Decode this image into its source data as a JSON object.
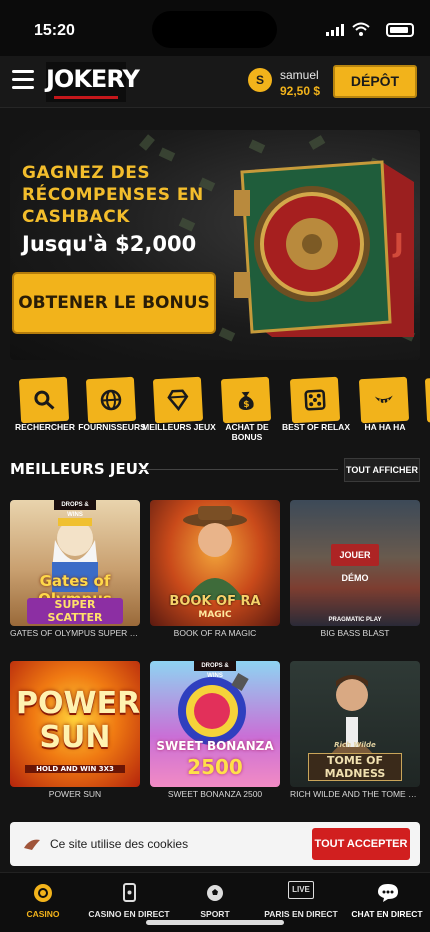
{
  "status_bar": {
    "time": "15:20"
  },
  "header": {
    "logo_text": "JOKERY",
    "username": "samuel",
    "balance": "92,50 $",
    "avatar_letter": "S",
    "deposit_label": "DÉPÔT"
  },
  "banner": {
    "headline": "GAGNEZ DES RÉCOMPENSES EN CASHBACK",
    "amount": "Jusqu'à $2,000",
    "cta_label": "OBTENER LE BONUS"
  },
  "categories": [
    {
      "label": "RECHERCHER",
      "icon": "search-icon"
    },
    {
      "label": "FOURNISSEURS",
      "icon": "globe-icon"
    },
    {
      "label": "MEILLEURS JEUX",
      "icon": "diamond-icon"
    },
    {
      "label": "ACHAT DE BONUS",
      "icon": "money-bag-icon"
    },
    {
      "label": "BEST OF RELAX",
      "icon": "dice-icon"
    },
    {
      "label": "HA HA HA",
      "icon": "joker-smile-icon"
    }
  ],
  "section": {
    "title": "MEILLEURS JEUX",
    "show_all_label": "TOUT AFFICHER"
  },
  "games": [
    {
      "name": "GATES OF OLYMPUS SUPER SCATTER",
      "thumb_title": "Gates of Olympus",
      "thumb_sub": "SUPER SCATTER",
      "tag": "DROPS & WINS"
    },
    {
      "name": "BOOK OF RA MAGIC",
      "thumb_title": "BOOK OF RA",
      "thumb_sub": "MAGIC"
    },
    {
      "name": "BIG BASS BLAST",
      "play_label": "JOUER",
      "demo_label": "DÉMO",
      "provider": "PRAGMATIC PLAY"
    },
    {
      "name": "POWER SUN",
      "thumb_title": "POWER SUN",
      "thumb_sub": "HOLD AND WIN 3X3"
    },
    {
      "name": "SWEET BONANZA 2500",
      "thumb_title": "SWEET BONANZA",
      "thumb_sub": "2500",
      "tag": "DROPS & WINS"
    },
    {
      "name": "RICH WILDE AND THE TOME OF MADN...",
      "thumb_title": "TOME OF MADNESS",
      "thumb_sub": "Rich Wilde"
    }
  ],
  "cookie": {
    "text": "Ce site utilise des cookies",
    "accept_label": "TOUT ACCEPTER"
  },
  "bottom_nav": [
    {
      "label": "CASINO",
      "icon": "casino-chip-icon",
      "active": true
    },
    {
      "label": "CASINO EN DIRECT",
      "icon": "cards-icon"
    },
    {
      "label": "SPORT",
      "icon": "football-icon"
    },
    {
      "label": "PARIS EN DIRECT",
      "icon": "live-icon",
      "badge": "LIVE"
    },
    {
      "label": "CHAT EN DIRECT",
      "icon": "chat-icon"
    }
  ],
  "colors": {
    "accent": "#f2b31b",
    "danger": "#d11f1f",
    "background": "#141414"
  }
}
